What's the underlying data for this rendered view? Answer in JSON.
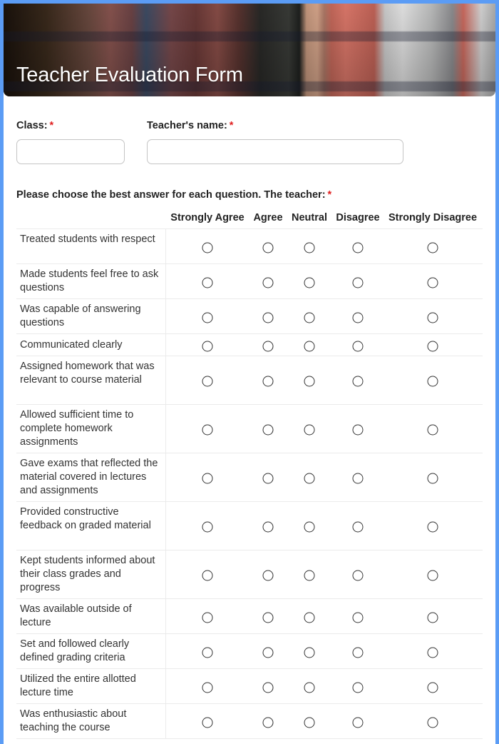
{
  "form": {
    "title": "Teacher Evaluation Form",
    "accent_color": "#5b9cf5",
    "required_mark": "*"
  },
  "fields": {
    "class_label": "Class:",
    "class_value": "",
    "teacher_label": "Teacher's name:",
    "teacher_value": ""
  },
  "matrix": {
    "question": "Please choose the best answer for each question. The teacher:",
    "columns": [
      "Strongly Agree",
      "Agree",
      "Neutral",
      "Disagree",
      "Strongly Disagree"
    ],
    "rows": [
      "Treated students with respect",
      "Made students feel free to ask questions",
      "Was capable of answering questions",
      "Communicated clearly",
      "Assigned homework that was relevant to course material",
      "Allowed sufficient time to complete homework assignments",
      "Gave exams that reflected the material covered in lectures and assignments",
      "Provided constructive feedback on graded material",
      "Kept students informed about their class grades and progress",
      "Was available outside of lecture",
      "Set and followed clearly defined grading criteria",
      "Utilized the entire allotted lecture time",
      "Was enthusiastic about teaching the course"
    ],
    "selected": [
      null,
      null,
      null,
      null,
      null,
      null,
      null,
      null,
      null,
      null,
      null,
      null,
      null
    ]
  }
}
